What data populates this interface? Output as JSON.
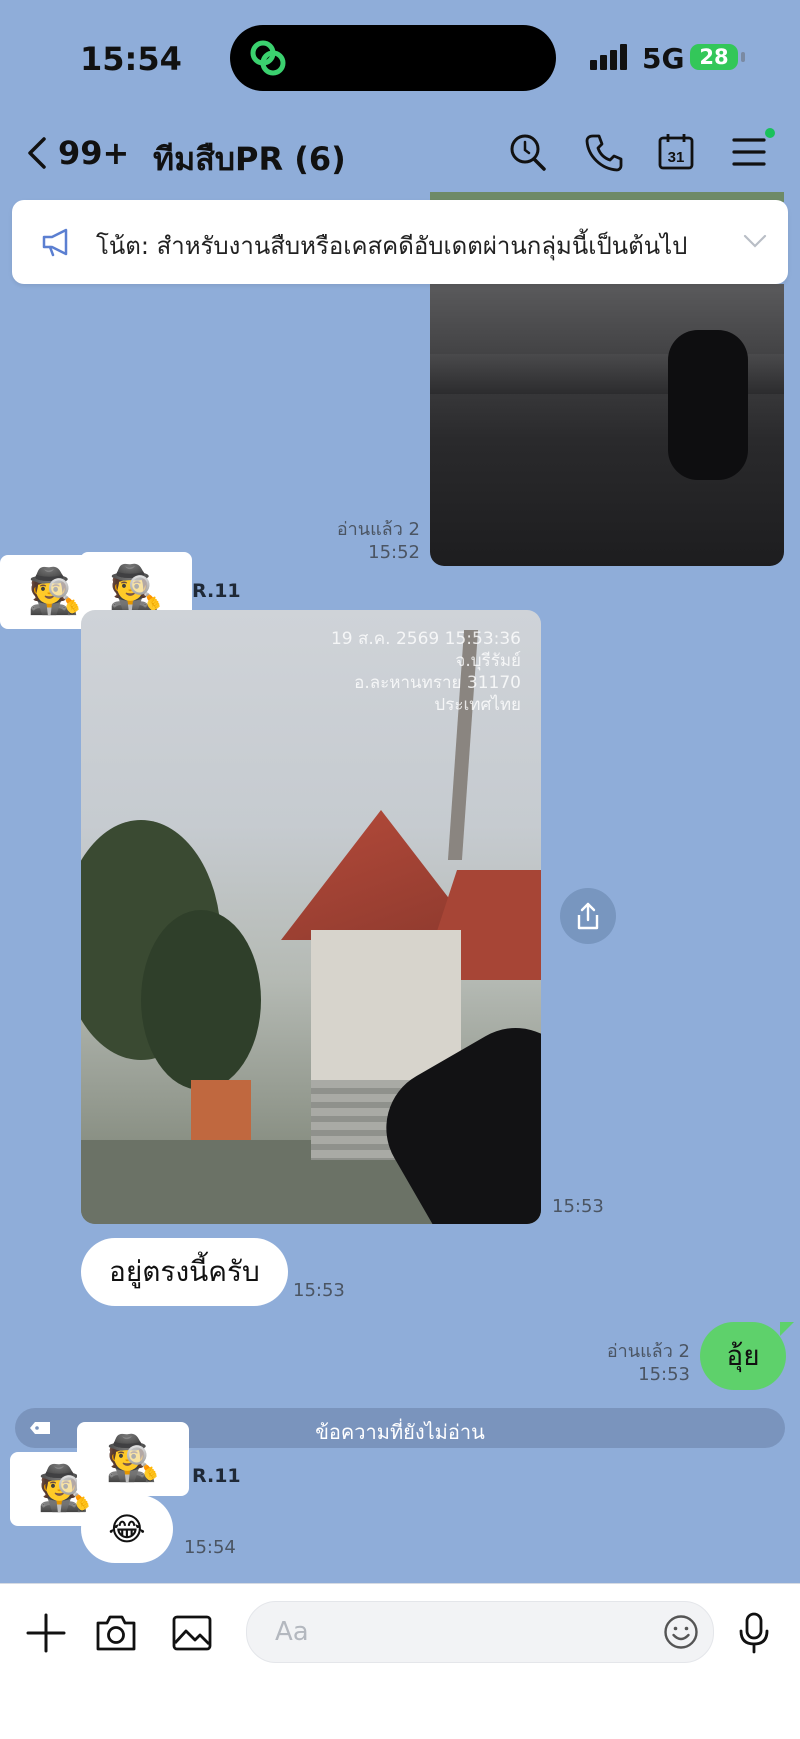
{
  "status_bar": {
    "time": "15:54",
    "network": "5G",
    "battery": "28"
  },
  "header": {
    "unread_count": "99+",
    "title": "ทีมสืบPR (6)"
  },
  "announcement": {
    "text": "โน้ต: สำหรับงานสืบหรือเคสคดีอับเดตผ่านกลุ่มนี้เป็นต้นไป"
  },
  "messages": {
    "m1": {
      "read_label": "อ่านแล้ว 2",
      "time": "15:52"
    },
    "m2": {
      "sender": "R.11",
      "avatar_emoji": "🕵️",
      "photo_stamp": [
        "19 ส.ค. 2569 15:53:36",
        "จ.บุรีรัมย์",
        "อ.ละหานทราย 31170",
        "ประเทศไทย"
      ],
      "time": "15:53"
    },
    "m3": {
      "text": "อยู่ตรงนี้ครับ",
      "time": "15:53"
    },
    "m4": {
      "text": "อุ้ย",
      "read_label": "อ่านแล้ว 2",
      "time": "15:53"
    },
    "unread_divider": "ข้อความที่ยังไม่อ่าน",
    "m5": {
      "sender": "R.11",
      "avatar_emoji": "🕵️",
      "text": "😂",
      "time": "15:54"
    }
  },
  "composer": {
    "placeholder": "Aa"
  },
  "colors": {
    "chat_bg": "#8fadd9",
    "sent_bubble": "#5ed16b",
    "battery": "#33c759"
  }
}
